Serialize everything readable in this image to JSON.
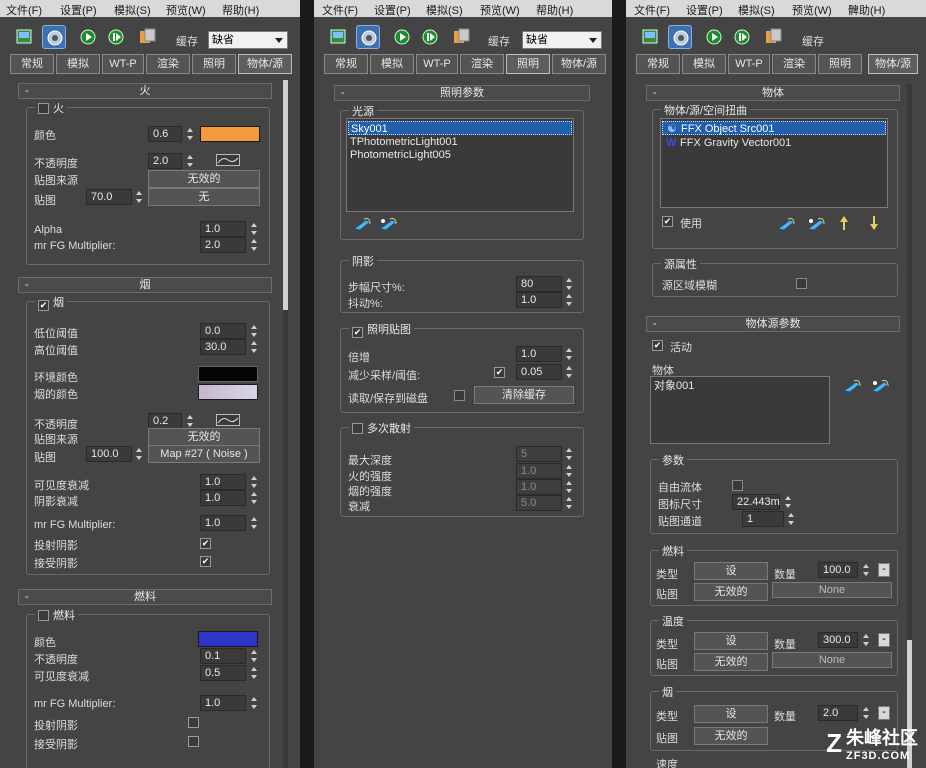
{
  "menus": {
    "file": "文件(F)",
    "settings": "设置(P)",
    "simulate": "模拟(S)",
    "preview": "预览(W)",
    "help": "帮助(H)",
    "help_alt": "髀助(H)"
  },
  "toolbar": {
    "cache_label": "缓存",
    "cache_value": "缺省"
  },
  "tabs": [
    "常规",
    "模拟",
    "WT-P",
    "渲染",
    "照明",
    "物体/源"
  ],
  "left": {
    "fire": {
      "title": "火",
      "enable": "火",
      "color_label": "颜色",
      "color_value": "0.6",
      "color": "#f59a3c",
      "opacity_label": "不透明度",
      "opacity_value": "2.0",
      "map_source_label": "贴图来源",
      "map_source_value": "无效的",
      "map_label": "贴图",
      "map_amount": "70.0",
      "map_button": "无",
      "alpha_label": "Alpha",
      "alpha_value": "1.0",
      "fg_label": "mr FG Multiplier:",
      "fg_value": "2.0"
    },
    "smoke": {
      "title": "烟",
      "enable": "烟",
      "low_label": "低位阈值",
      "low_value": "0.0",
      "high_label": "高位阈值",
      "high_value": "30.0",
      "ambient_label": "环境颜色",
      "ambient_color": "#050505",
      "smoke_color_label": "烟的颜色",
      "smoke_color": "#c8c8d8",
      "opacity_label": "不透明度",
      "opacity_value": "0.2",
      "map_source_label": "贴图来源",
      "map_source_value": "无效的",
      "map_label": "贴图",
      "map_amount": "100.0",
      "map_button": "Map #27  ( Noise )",
      "vis_label": "可见度衰减",
      "vis_value": "1.0",
      "shadow_label": "阴影衰减",
      "shadow_value": "1.0",
      "fg_label": "mr FG Multiplier:",
      "fg_value": "1.0",
      "cast_label": "投射阴影",
      "recv_label": "接受阴影"
    },
    "fuel": {
      "title": "燃料",
      "enable": "燃料",
      "color_label": "颜色",
      "color": "#2d36c8",
      "opacity_label": "不透明度",
      "opacity_value": "0.1",
      "vis_label": "可见度衰减",
      "vis_value": "0.5",
      "fg_label": "mr FG Multiplier:",
      "fg_value": "1.0",
      "cast_label": "投射阴影",
      "recv_label": "接受阴影"
    }
  },
  "middle": {
    "lighting": {
      "title": "照明参数",
      "light_group": "光源",
      "lights": [
        "Sky001",
        "TPhotometricLight001",
        "PhotometricLight005"
      ]
    },
    "shadow": {
      "title": "阴影",
      "step_label": "步幅尺寸%:",
      "step_value": "80",
      "jitter_label": "抖动%:",
      "jitter_value": "1.0"
    },
    "lightmap": {
      "title": "照明贴图",
      "mult_label": "倍增",
      "mult_value": "1.0",
      "reduce_label": "减少采样/阈值:",
      "reduce_value": "0.05",
      "rw_label": "读取/保存到磁盘",
      "clear_button": "清除缓存"
    },
    "scatter": {
      "title": "多次散射",
      "depth_label": "最大深度",
      "depth_value": "5",
      "fire_label": "火的强度",
      "fire_value": "1.0",
      "smoke_label": "烟的强度",
      "smoke_value": "1.0",
      "decay_label": "衰减",
      "decay_value": "5.0"
    }
  },
  "right": {
    "object": {
      "title": "物体",
      "group": "物体/源/空间扭曲",
      "items": [
        "FFX Object Src001",
        "FFX Gravity Vector001"
      ],
      "use_label": "使用"
    },
    "source_props": {
      "title": "源属性",
      "blur_label": "源区域模糊"
    },
    "source_params": {
      "title": "物体源参数",
      "active_label": "活动",
      "object_label": "物体",
      "object_item": "对象001"
    },
    "params": {
      "title": "参数",
      "free_label": "自由流体",
      "icon_label": "图标尺寸",
      "icon_value": "22.443m",
      "map_channel_label": "贴图通道",
      "map_channel_value": "1"
    },
    "fuel": {
      "title": "燃料",
      "type_label": "类型",
      "type_value": "设",
      "amount_label": "数量",
      "amount_value": "100.0",
      "map_label": "贴图",
      "map_value": "无效的",
      "map_button": "None"
    },
    "temp": {
      "title": "温度",
      "type_label": "类型",
      "type_value": "设",
      "amount_label": "数量",
      "amount_value": "300.0",
      "map_label": "贴图",
      "map_value": "无效的",
      "map_button": "None"
    },
    "smoke": {
      "title": "烟",
      "type_label": "类型",
      "type_value": "设",
      "amount_label": "数量",
      "amount_value": "2.0",
      "map_label": "贴图",
      "map_value": "无效的",
      "next_label": "速度"
    }
  },
  "watermark": {
    "brand": "朱峰社区",
    "url": "ZF3D.COM"
  }
}
